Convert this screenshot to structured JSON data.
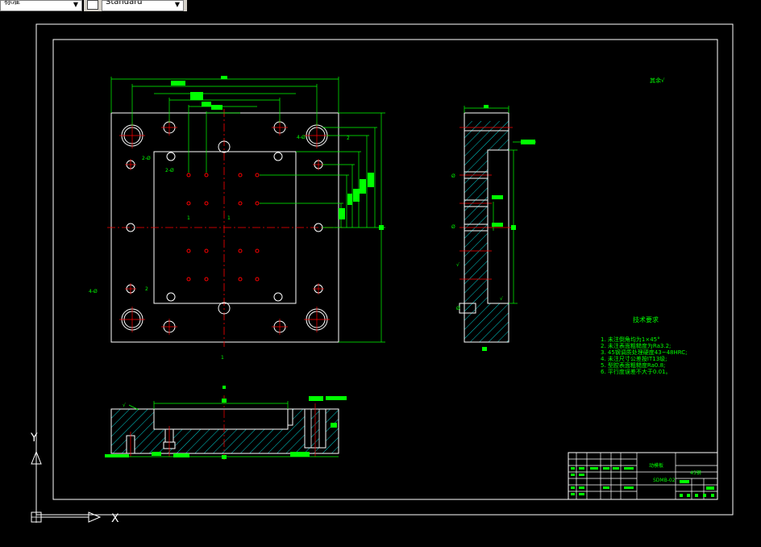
{
  "toolbar": {
    "text_style": "标准",
    "dim_style": "Standard"
  },
  "drawing": {
    "tech_title": "技术要求",
    "tech_requirements": [
      "1. 未注倒角均为1×45°",
      "2. 未注表面粗糙度为Ra3.2;",
      "3. 45钢调质处理硬度43~48HRC;",
      "4. 未注尺寸公差按IT13级;",
      "5. 型腔表面粗糙度Ra0.8;",
      "6. 平行度误差不大于0.01。"
    ],
    "title_block": {
      "part_name": "动模板",
      "material": "45钢",
      "drawing_no": "SDMB-02"
    },
    "roughness_note": "其余√"
  },
  "ucs": {
    "y_label": "Y",
    "x_label": "X"
  },
  "colors": {
    "background": "#000000",
    "outline": "#ffffff",
    "dimension": "#00ff00",
    "centerline": "#ff0000",
    "hatch": "#00ffff"
  }
}
